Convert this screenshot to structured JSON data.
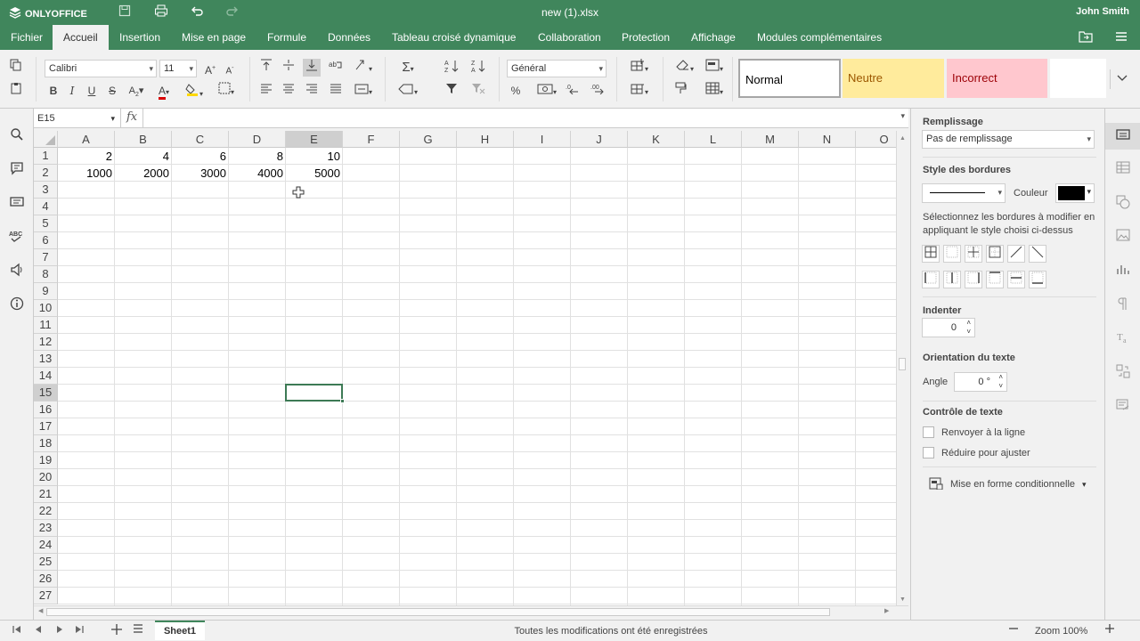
{
  "app": {
    "logo_text": "ONLYOFFICE",
    "doc_title": "new (1).xlsx",
    "user_name": "John Smith"
  },
  "quick_access": [
    "save-icon",
    "print-icon",
    "undo-icon",
    "redo-icon"
  ],
  "menu_tabs": [
    {
      "label": "Fichier",
      "active": false
    },
    {
      "label": "Accueil",
      "active": true
    },
    {
      "label": "Insertion",
      "active": false
    },
    {
      "label": "Mise en page",
      "active": false
    },
    {
      "label": "Formule",
      "active": false
    },
    {
      "label": "Données",
      "active": false
    },
    {
      "label": "Tableau croisé dynamique",
      "active": false
    },
    {
      "label": "Collaboration",
      "active": false
    },
    {
      "label": "Protection",
      "active": false
    },
    {
      "label": "Affichage",
      "active": false
    },
    {
      "label": "Modules complémentaires",
      "active": false
    }
  ],
  "toolbar": {
    "font_name": "Calibri",
    "font_size": "11",
    "number_format": "Général",
    "bold": "B",
    "italic": "I",
    "underline": "U",
    "strike": "S",
    "percent": "%",
    "cell_styles": [
      {
        "label": "Normal",
        "bg": "#ffffff",
        "fg": "#000000",
        "border": "#a6a6a6"
      },
      {
        "label": "Neutre",
        "bg": "#ffeb9c",
        "fg": "#9c5700",
        "border": "#ffeb9c"
      },
      {
        "label": "Incorrect",
        "bg": "#ffc7ce",
        "fg": "#9c0006",
        "border": "#ffc7ce"
      },
      {
        "label": "",
        "bg": "#ffffff",
        "fg": "#000000",
        "border": "#ffffff"
      }
    ]
  },
  "formula_bar": {
    "cell_ref": "E15",
    "fx_label": "fx",
    "content": ""
  },
  "sheet": {
    "columns": [
      "A",
      "B",
      "C",
      "D",
      "E",
      "F",
      "G",
      "H",
      "I",
      "J",
      "K",
      "L",
      "M",
      "N",
      "O"
    ],
    "selected_column": "E",
    "rows": [
      "1",
      "2",
      "3",
      "4",
      "5",
      "6",
      "7",
      "8",
      "9",
      "10",
      "11",
      "12",
      "13",
      "14",
      "15",
      "16",
      "17",
      "18",
      "19",
      "20",
      "21",
      "22",
      "23",
      "24",
      "25",
      "26",
      "27"
    ],
    "selected_row": "15",
    "cells": [
      [
        "2",
        "4",
        "6",
        "8",
        "10"
      ],
      [
        "1000",
        "2000",
        "3000",
        "4000",
        "5000"
      ]
    ],
    "active_cell": "E15"
  },
  "status_bar": {
    "sheet_tab": "Sheet1",
    "save_status": "Toutes les modifications ont été enregistrées",
    "zoom_label": "Zoom 100%"
  },
  "right_panel": {
    "fill_label": "Remplissage",
    "fill_value": "Pas de remplissage",
    "border_style_label": "Style des bordures",
    "color_label": "Couleur",
    "border_color": "#000000",
    "border_hint": "Sélectionnez les bordures à modifier en appliquant le style choisi ci-dessus",
    "indent_label": "Indenter",
    "indent_value": "0",
    "orientation_label": "Orientation du texte",
    "angle_label": "Angle",
    "angle_value": "0 °",
    "text_control_label": "Contrôle de texte",
    "wrap_label": "Renvoyer à la ligne",
    "shrink_label": "Réduire pour ajuster",
    "cond_format_label": "Mise en forme conditionnelle"
  },
  "colors": {
    "accent": "#40865c",
    "selection": "#3d7a55"
  }
}
